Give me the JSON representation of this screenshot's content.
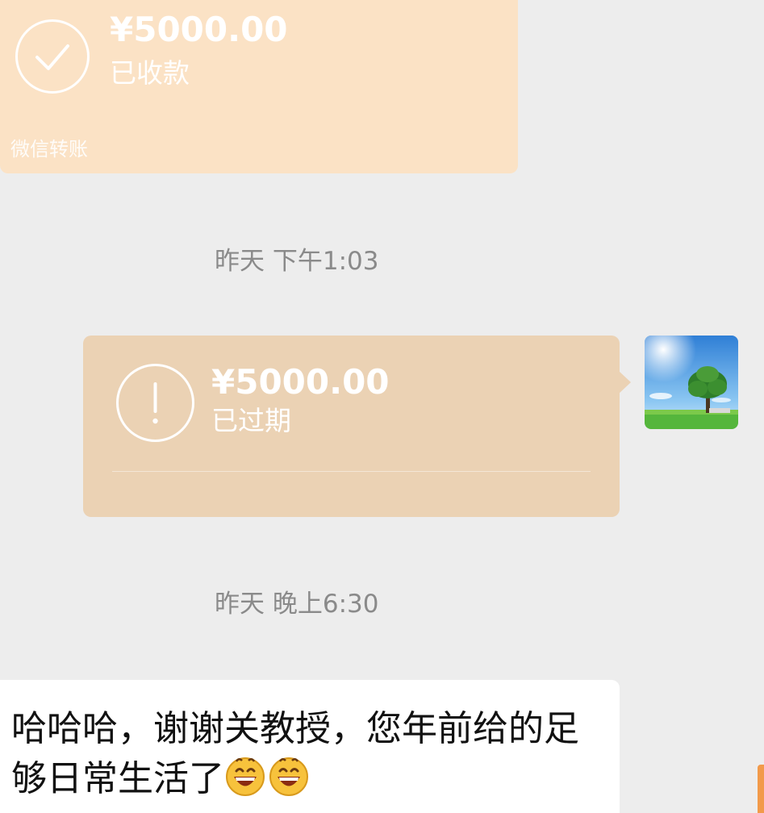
{
  "transfers": [
    {
      "amount": "¥5000.00",
      "status": "已收款",
      "label": "微信转账",
      "icon": "check-icon",
      "color": "#fbe2c5"
    },
    {
      "amount": "¥5000.00",
      "status": "已过期",
      "icon": "exclamation-icon",
      "color": "#ebd2b4"
    }
  ],
  "timestamps": [
    "昨天 下午1:03",
    "昨天 晚上6:30"
  ],
  "message": {
    "text": "哈哈哈，谢谢关教授，您年前给的足够日常生活了",
    "emojis": [
      "grinning-face-emoji",
      "grinning-face-emoji"
    ]
  },
  "avatar": {
    "icon": "tree-landscape-avatar"
  },
  "colors": {
    "background": "#ededed",
    "timestamp": "#8a8a8a",
    "bubble": "#ffffff",
    "accent": "#f29a4a"
  }
}
